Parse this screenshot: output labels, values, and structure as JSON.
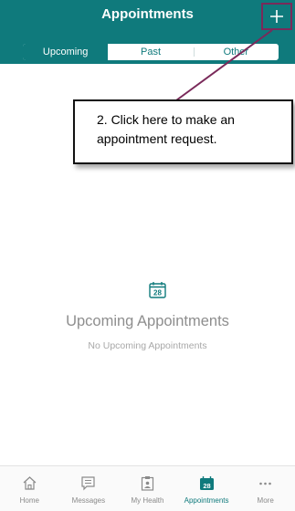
{
  "header": {
    "title": "Appointments",
    "add_icon": "plus-icon"
  },
  "segments": [
    {
      "label": "Upcoming",
      "active": true
    },
    {
      "label": "Past",
      "active": false
    },
    {
      "label": "Other",
      "active": false
    }
  ],
  "callout": {
    "text": "2. Click here to make an appointment request."
  },
  "empty_state": {
    "icon": "calendar-icon",
    "icon_number": "28",
    "title": "Upcoming Appointments",
    "subtitle": "No Upcoming Appointments"
  },
  "tabbar": {
    "items": [
      {
        "label": "Home",
        "icon": "home-icon",
        "active": false
      },
      {
        "label": "Messages",
        "icon": "message-icon",
        "active": false
      },
      {
        "label": "My Health",
        "icon": "clipboard-icon",
        "active": false
      },
      {
        "label": "Appointments",
        "icon": "calendar-icon",
        "icon_number": "28",
        "active": true
      },
      {
        "label": "More",
        "icon": "more-icon",
        "active": false
      }
    ]
  },
  "colors": {
    "brand": "#0f7a7c",
    "annotation": "#7a2a5a"
  }
}
